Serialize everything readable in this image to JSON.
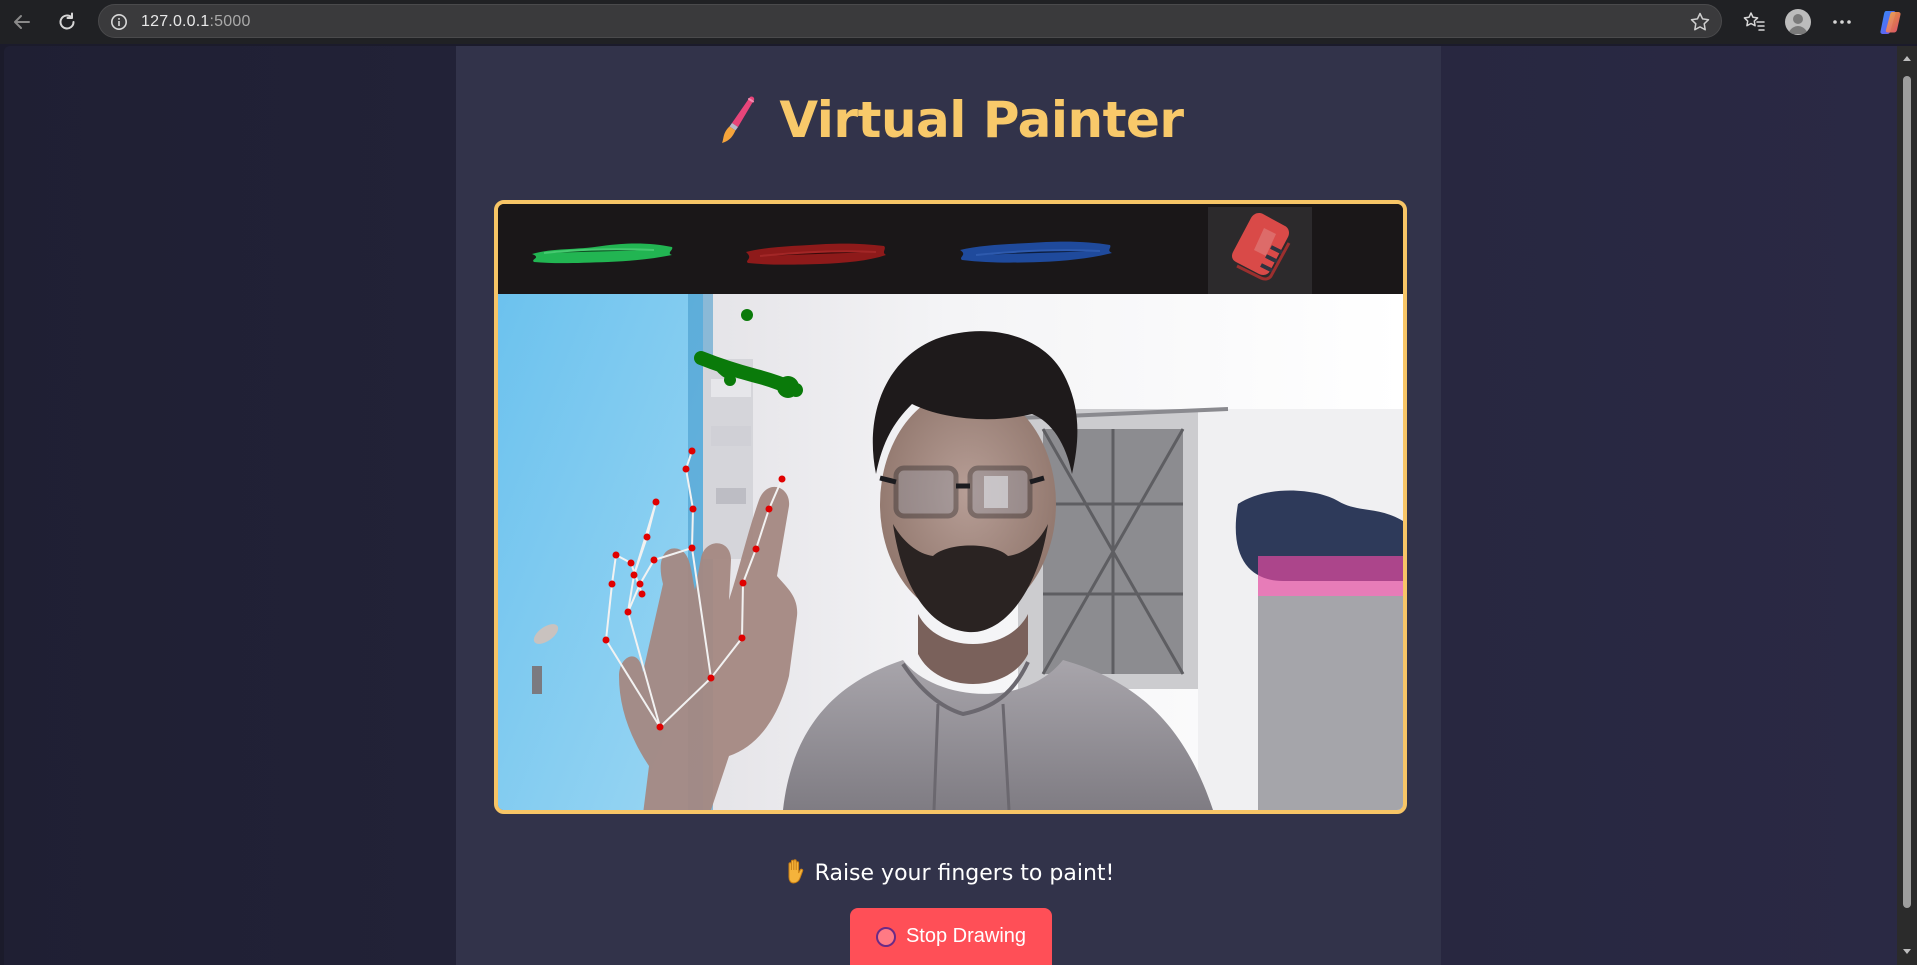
{
  "browser": {
    "url_host": "127.0.0.1",
    "url_port": ":5000",
    "icons": [
      "back-arrow-icon",
      "reload-icon",
      "info-icon",
      "star-icon",
      "favorites-icon",
      "profile-icon",
      "more-icon",
      "copilot-icon"
    ]
  },
  "page": {
    "title": "Virtual Painter",
    "title_icon": "paintbrush-icon",
    "hint_text": "Raise your fingers to paint!",
    "hint_icon": "raised-hand-icon",
    "stop_button_label": "Stop Drawing",
    "stop_button_icon": "circle-icon"
  },
  "toolbar": {
    "colors": [
      {
        "name": "green-brush",
        "hex": "#22b552"
      },
      {
        "name": "red-brush",
        "hex": "#8e1a1a"
      },
      {
        "name": "blue-brush",
        "hex": "#1f4a9c"
      }
    ],
    "eraser": "eraser-icon"
  },
  "colors": {
    "accent": "#f7c566",
    "panel": "#32334a",
    "button": "#ff4f57",
    "stroke": "#0a7a0a",
    "landmark": "#e00000"
  }
}
